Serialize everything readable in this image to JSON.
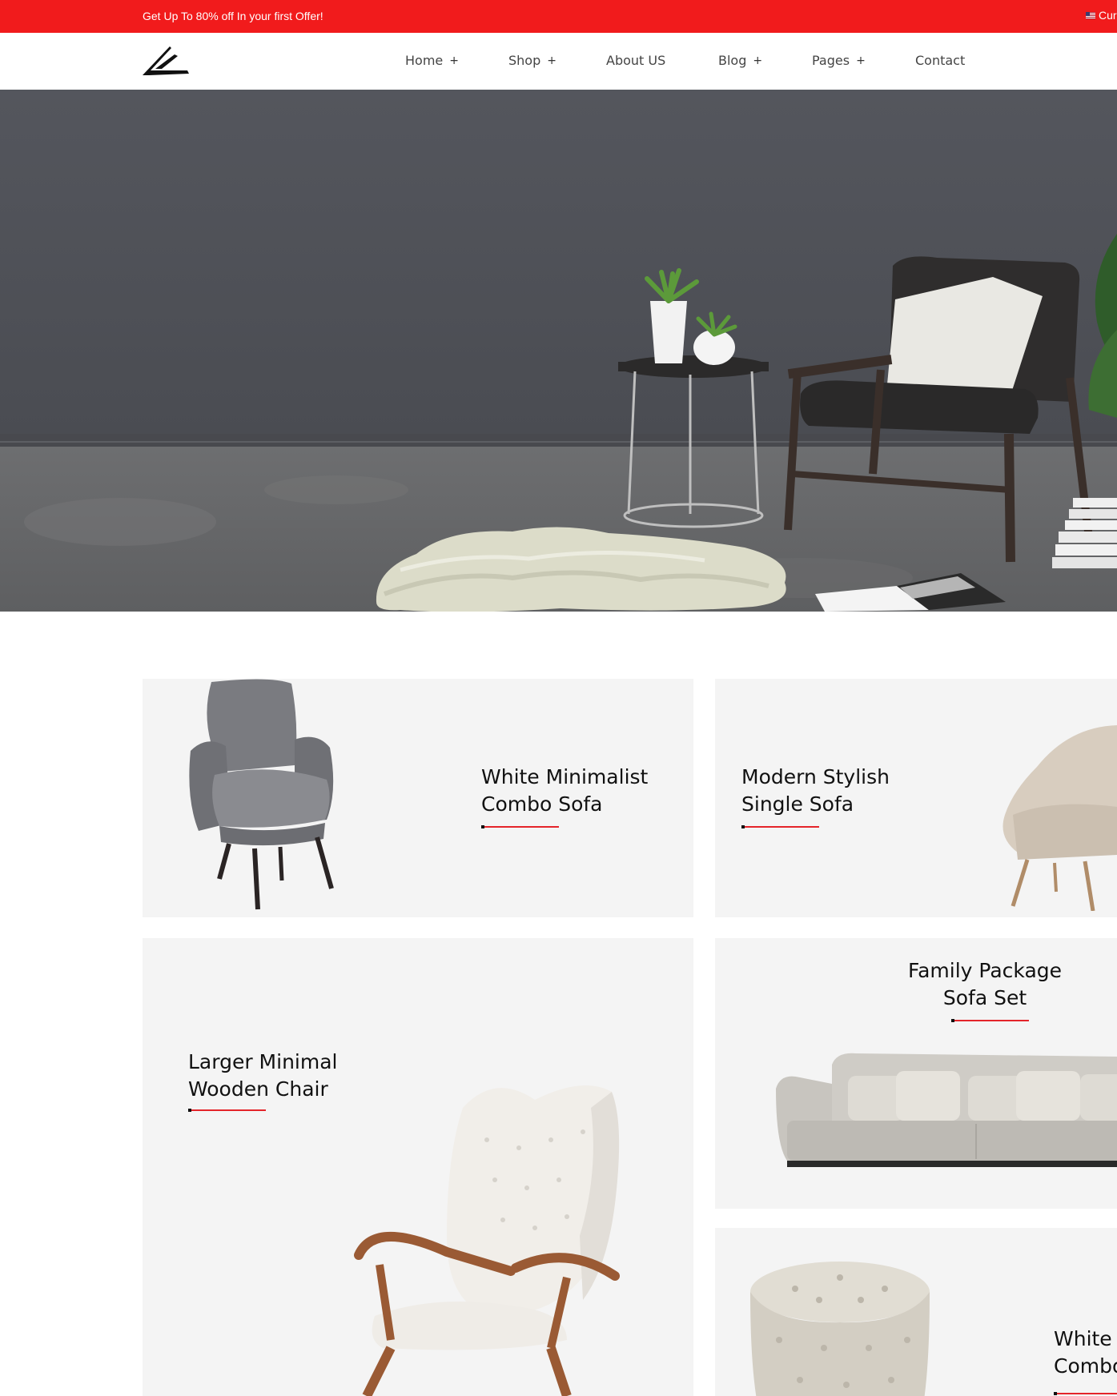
{
  "colors": {
    "accent": "#f11b1c",
    "underline": "#e4242a",
    "card_bg": "#f4f4f4"
  },
  "topbar": {
    "offer": "Get Up To 80% off In your first Offer!",
    "currency_partial": "Cur",
    "flag_icon": "us-flag-icon"
  },
  "header": {
    "logo_icon": "arrow-logo-icon",
    "nav": [
      {
        "label": "Home",
        "has_submenu": true
      },
      {
        "label": "Shop",
        "has_submenu": true
      },
      {
        "label": "About US",
        "has_submenu": false
      },
      {
        "label": "Blog",
        "has_submenu": true
      },
      {
        "label": "Pages",
        "has_submenu": true
      },
      {
        "label": "Contact",
        "has_submenu": false
      }
    ],
    "submenu_symbol": "+"
  },
  "cards": {
    "c1": {
      "title": "White Minimalist\nCombo Sofa"
    },
    "c2": {
      "title": "Modern Stylish\nSingle Sofa"
    },
    "c3": {
      "title": "Larger Minimal\nWooden Chair"
    },
    "c4": {
      "title": "Family Package\nSofa Set"
    },
    "c5": {
      "title": "White\nCombo"
    }
  }
}
